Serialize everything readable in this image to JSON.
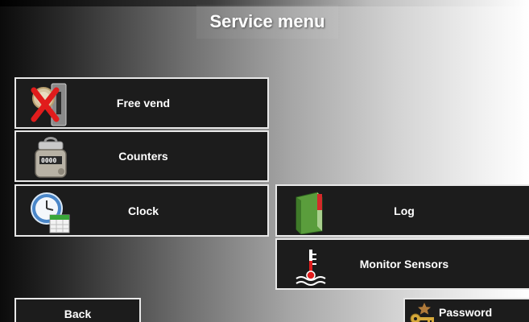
{
  "header": {
    "title": "Service menu"
  },
  "buttons": {
    "free_vend": {
      "label": "Free vend",
      "icon": "coin-slot-x-icon"
    },
    "counters": {
      "label": "Counters",
      "icon": "counter-device-icon"
    },
    "clock": {
      "label": "Clock",
      "icon": "clock-calendar-icon"
    },
    "log": {
      "label": "Log",
      "icon": "log-book-icon"
    },
    "monitor_sensors": {
      "label": "Monitor Sensors",
      "icon": "thermometer-icon"
    },
    "back": {
      "label": "Back"
    },
    "password": {
      "label": "Password",
      "icon": "key-icon"
    }
  },
  "colors": {
    "button_bg": "#1c1c1c",
    "button_border": "#e8e8e8",
    "text": "#ffffff"
  }
}
